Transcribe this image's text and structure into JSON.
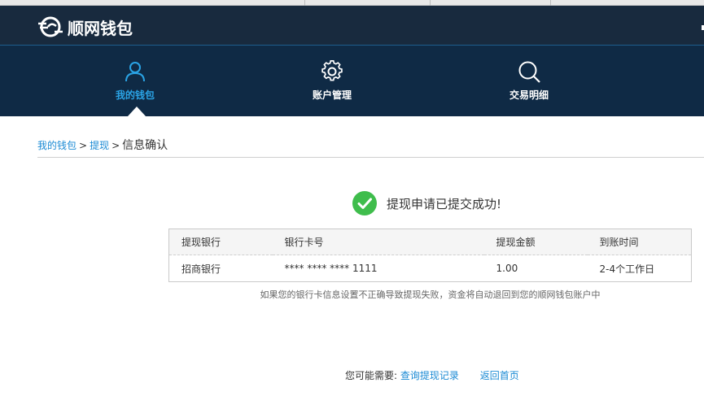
{
  "header": {
    "logo_text": "顺网钱包"
  },
  "nav": {
    "items": [
      {
        "label": "我的钱包",
        "icon": "user-icon",
        "active": true
      },
      {
        "label": "账户管理",
        "icon": "gear-icon",
        "active": false
      },
      {
        "label": "交易明细",
        "icon": "search-icon",
        "active": false
      }
    ]
  },
  "breadcrumb": {
    "wallet": "我的钱包",
    "sep1": ">",
    "withdraw": "提现",
    "sep2": ">",
    "current": "信息确认"
  },
  "success": {
    "icon": "check-circle-icon",
    "message": "提现申请已提交成功!"
  },
  "table": {
    "headers": [
      "提现银行",
      "银行卡号",
      "提现金额",
      "到账时间"
    ],
    "rows": [
      [
        "招商银行",
        "**** **** **** 1111",
        "1.00",
        "2-4个工作日"
      ]
    ]
  },
  "note": "如果您的银行卡信息设置不正确导致提现失败，资金将自动退回到您的顺网钱包账户中",
  "footer": {
    "lead": "您可能需要:",
    "link_records": "查询提现记录",
    "link_home": "返回首页"
  },
  "colors": {
    "header_bg": "#182a3e",
    "nav_bg": "#0f2a45",
    "accent": "#2aa3e5",
    "link": "#1a8ad4",
    "success_green": "#3fbd4c"
  }
}
